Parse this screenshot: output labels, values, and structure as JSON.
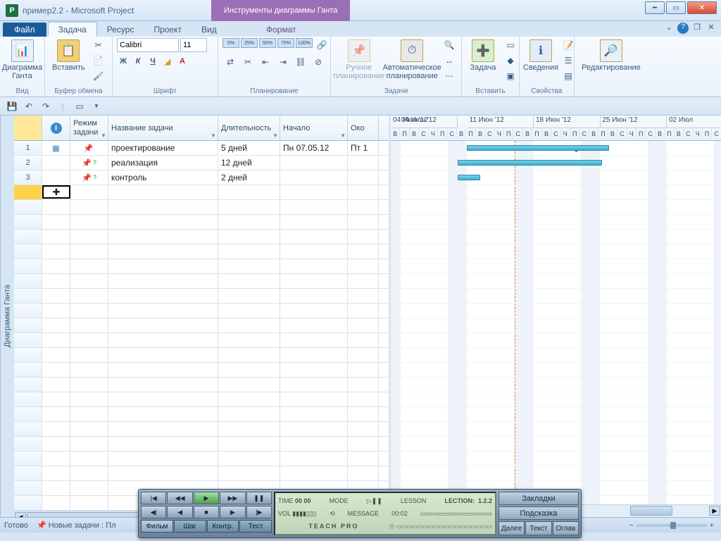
{
  "app": {
    "icon_letter": "P",
    "title": "пример2.2  -  Microsoft Project",
    "context_tab": "Инструменты диаграммы Ганта"
  },
  "tabs": {
    "file": "Файл",
    "items": [
      "Задача",
      "Ресурс",
      "Проект",
      "Вид"
    ],
    "active_index": 0,
    "context": "Формат"
  },
  "ribbon": {
    "groups": {
      "view": {
        "label": "Вид",
        "gantt": "Диаграмма\nГанта"
      },
      "clipboard": {
        "label": "Буфер обмена",
        "paste": "Вставить"
      },
      "font": {
        "label": "Шрифт",
        "name": "Calibri",
        "size": "11",
        "bold": "Ж",
        "italic": "К",
        "underline": "Ч"
      },
      "schedule": {
        "label": "Планирование",
        "percents": [
          "0%",
          "25%",
          "50%",
          "75%",
          "100%"
        ]
      },
      "tasks": {
        "label": "Задачи",
        "manual": "Ручное\nпланирование",
        "auto": "Автоматическое\nпланирование"
      },
      "insert": {
        "label": "Вставить",
        "task": "Задача"
      },
      "properties": {
        "label": "Свойства",
        "info": "Сведения"
      },
      "editing": {
        "label": "Редактирование"
      }
    }
  },
  "columns": {
    "info": "",
    "mode": "Режим задачи",
    "name": "Название задачи",
    "duration": "Длительность",
    "start": "Начало",
    "finish": "Око"
  },
  "tasks": [
    {
      "id": 1,
      "name": "проектирование",
      "duration": "5 дней",
      "start": "Пн 07.05.12",
      "finish": "Пт 1",
      "mode": "manual",
      "info": "table"
    },
    {
      "id": 2,
      "name": "реализация",
      "duration": "12 дней",
      "start": "",
      "finish": "",
      "mode": "manual-q"
    },
    {
      "id": 3,
      "name": "контроль",
      "duration": "2 дней",
      "start": "",
      "finish": "",
      "mode": "manual-q"
    }
  ],
  "timeline": {
    "weeks": [
      "04 Июн '12",
      "11 Июн '12",
      "18 Июн '12",
      "25 Июн '12",
      "02 Июл"
    ],
    "day_letters": [
      "В",
      "П",
      "В",
      "С",
      "Ч",
      "П",
      "С"
    ]
  },
  "vtab": "Диаграмма Ганта",
  "status": {
    "ready": "Готово",
    "newtasks": "Новые задачи : Пл"
  },
  "player": {
    "modes": [
      "Фильм",
      "Шаг",
      "Контр.",
      "Тест"
    ],
    "time_label": "TIME",
    "time": "00 00",
    "mode_label": "MODE",
    "lesson_label": "LESSON",
    "lesson": "LECTION:",
    "lesson_no": "1.2.2",
    "vol_label": "VOL",
    "msg_label": "MESSAGE",
    "elapsed": "00:02",
    "brand": "TEACH PRO",
    "bookmarks": "Закладки",
    "hint": "Подсказка",
    "next": "Далее",
    "text": "Текст",
    "toc": "Оглав"
  }
}
